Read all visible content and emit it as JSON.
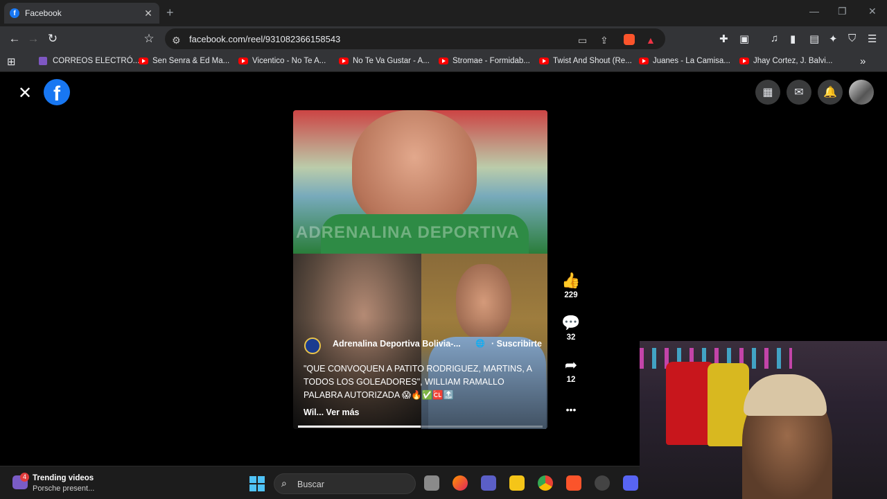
{
  "browser": {
    "tab": {
      "favicon": "f",
      "title": "Facebook",
      "close": "✕"
    },
    "new_tab": "+",
    "window_controls": {
      "minimize": "—",
      "restore": "❐",
      "close": "✕"
    },
    "nav": {
      "back": "←",
      "forward": "→",
      "reload": "↻",
      "bookmark": "☆"
    },
    "url": "facebook.com/reel/931082366158543",
    "brave_badge": "1",
    "bookmarks": [
      {
        "icon": "mail-icon",
        "label": "CORREOS ELECTRÓ..."
      },
      {
        "icon": "youtube-icon",
        "label": "Sen Senra & Ed Ma..."
      },
      {
        "icon": "youtube-icon",
        "label": "Vicentico - No Te A..."
      },
      {
        "icon": "youtube-icon",
        "label": "No Te Va Gustar - A..."
      },
      {
        "icon": "youtube-icon",
        "label": "Stromae - Formidab..."
      },
      {
        "icon": "youtube-icon",
        "label": "Twist And Shout (Re..."
      },
      {
        "icon": "youtube-icon",
        "label": "Juanes - La Camisa..."
      },
      {
        "icon": "youtube-icon",
        "label": "Jhay Cortez, J. Balvi..."
      }
    ],
    "bookmarks_overflow": "»"
  },
  "facebook": {
    "close": "✕",
    "logo": "f",
    "top_icons": [
      "menu-grid-icon",
      "messenger-icon",
      "notifications-icon"
    ],
    "reel": {
      "watermark": "ADRENALINA DEPORTIVA",
      "page_name": "Adrenalina Deportiva Bolivia-...",
      "globe": "🌐",
      "subscribe": "· Suscribirte",
      "caption": "\"QUE CONVOQUEN A PATITO RODRIGUEZ, MARTINS, A TODOS LOS GOLEADORES\", WILLIAM RAMALLO PALABRA AUTORIZADA 😱🔥✅🆑🔝",
      "caption_tail": "Wil...",
      "see_more": "Ver más",
      "progress_fraction": 0.5
    },
    "actions": {
      "like": {
        "icon": "👍",
        "count": "229"
      },
      "comment": {
        "icon": "💬",
        "count": "32"
      },
      "share": {
        "icon": "➦",
        "count": "12"
      },
      "more": {
        "icon": "•••"
      }
    }
  },
  "taskbar": {
    "widget_badge": "4",
    "widget_title": "Trending videos",
    "widget_subtitle": "Porsche present...",
    "search_icon": "⌕",
    "search_placeholder": "Buscar"
  }
}
